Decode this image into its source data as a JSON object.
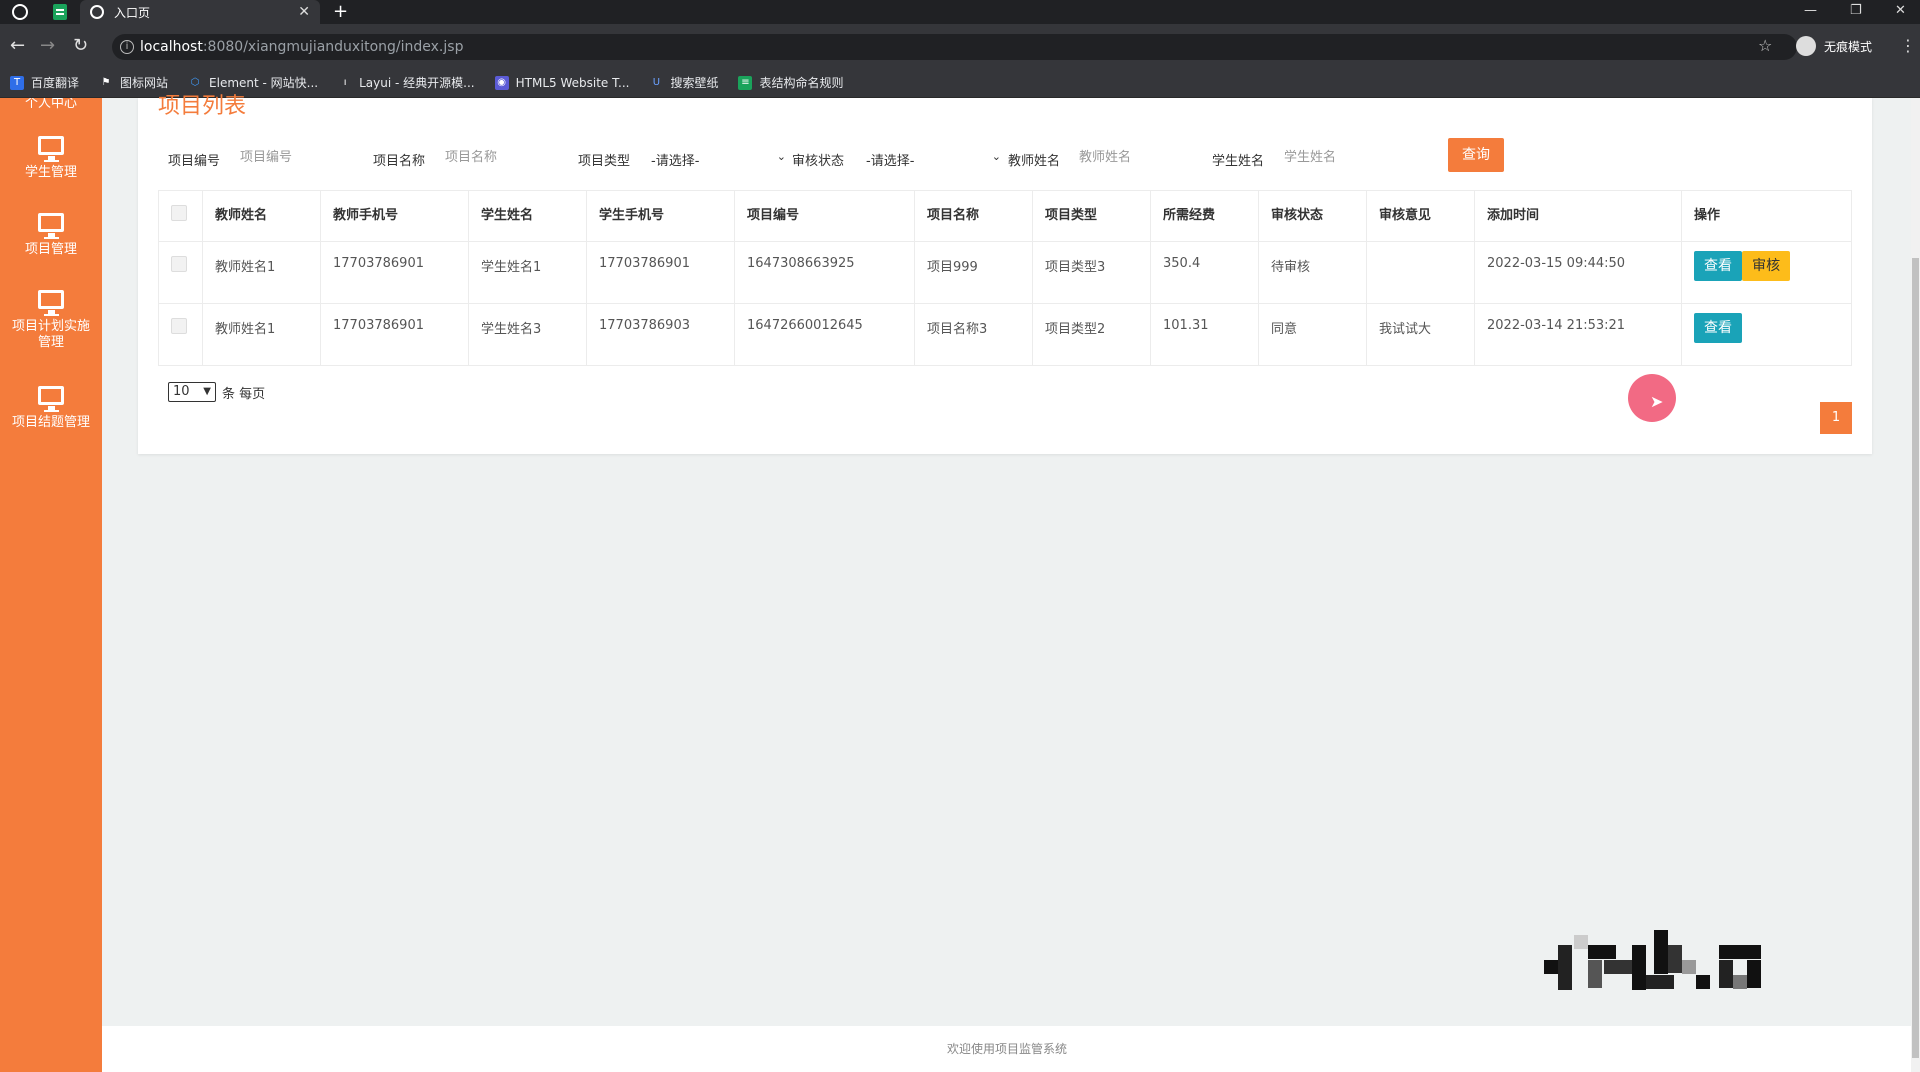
{
  "browser": {
    "tab_title": "入口页",
    "url_host": "localhost",
    "url_path": ":8080/xiangmujianduxitong/index.jsp",
    "incognito_label": "无痕模式",
    "bookmarks": [
      {
        "label": "百度翻译",
        "color": "#2f6ee8"
      },
      {
        "label": "图标网站",
        "color": "#444"
      },
      {
        "label": "Element - 网站快...",
        "color": "#409eff"
      },
      {
        "label": "Layui - 经典开源模...",
        "color": "#555"
      },
      {
        "label": "HTML5 Website T...",
        "color": "#5b5bd6"
      },
      {
        "label": "搜索壁纸",
        "color": "#3a5bd9"
      },
      {
        "label": "表结构命名规则",
        "color": "#1aa35b"
      }
    ]
  },
  "sidebar": {
    "top_label": "个人中心",
    "items": [
      {
        "label": "学生管理"
      },
      {
        "label": "项目管理"
      },
      {
        "label": "项目计划实施管理"
      },
      {
        "label": "项目结题管理"
      }
    ]
  },
  "page": {
    "title": "项目列表",
    "filters": {
      "project_no_label": "项目编号",
      "project_no_placeholder": "项目编号",
      "project_name_label": "项目名称",
      "project_name_placeholder": "项目名称",
      "project_type_label": "项目类型",
      "project_type_value": "-请选择-",
      "audit_status_label": "审核状态",
      "audit_status_value": "-请选择-",
      "teacher_name_label": "教师姓名",
      "teacher_name_placeholder": "教师姓名",
      "student_name_label": "学生姓名",
      "student_name_placeholder": "学生姓名",
      "query_label": "查询"
    },
    "table": {
      "headers": [
        "教师姓名",
        "教师手机号",
        "学生姓名",
        "学生手机号",
        "项目编号",
        "项目名称",
        "项目类型",
        "所需经费",
        "审核状态",
        "审核意见",
        "添加时间",
        "操作"
      ],
      "rows": [
        {
          "teacher": "教师姓名1",
          "teacher_phone": "17703786901",
          "student": "学生姓名1",
          "student_phone": "17703786901",
          "project_no": "1647308663925",
          "project_name": "项目999",
          "project_type": "项目类型3",
          "funds": "350.4",
          "status": "待审核",
          "opinion": "",
          "time": "2022-03-15 09:44:50",
          "view_label": "查看",
          "audit_label": "审核"
        },
        {
          "teacher": "教师姓名1",
          "teacher_phone": "17703786901",
          "student": "学生姓名3",
          "student_phone": "17703786903",
          "project_no": "16472660012645",
          "project_name": "项目名称3",
          "project_type": "项目类型2",
          "funds": "101.31",
          "status": "同意",
          "opinion": "我试试大",
          "time": "2022-03-14 21:53:21",
          "view_label": "查看"
        }
      ]
    },
    "pagination": {
      "page_size": "10",
      "page_size_suffix": "条 每页",
      "current_page": "1"
    }
  },
  "footer": {
    "text": "欢迎使用项目监管系统"
  }
}
